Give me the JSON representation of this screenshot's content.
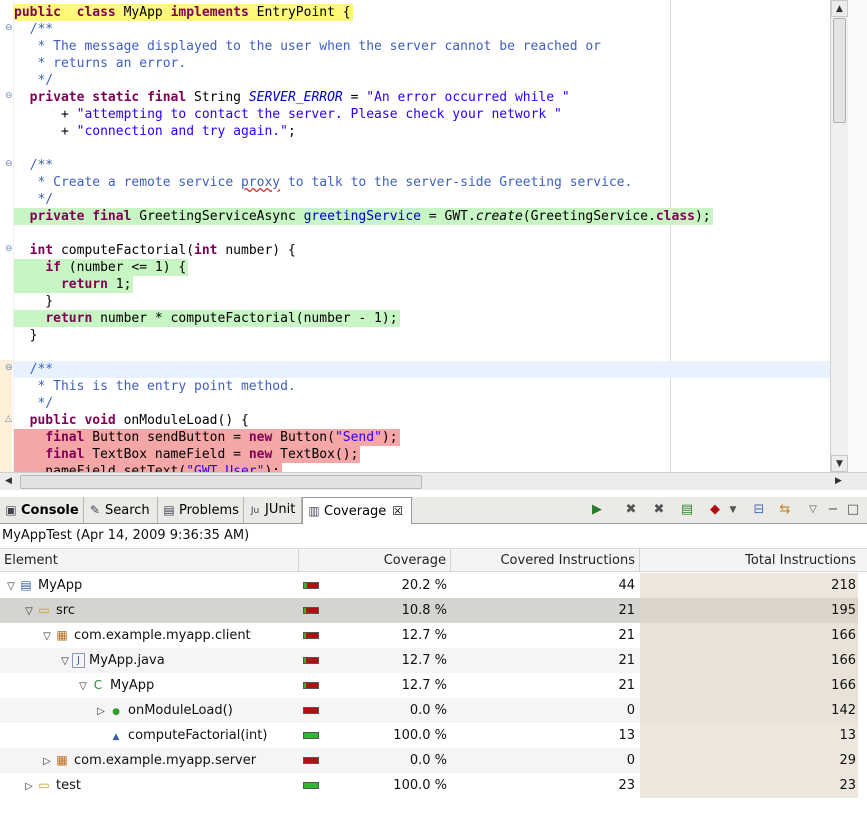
{
  "editor": {
    "lines": [
      {
        "hl": "y",
        "fold": "",
        "segs": [
          [
            "kw",
            "public"
          ],
          [
            "",
            "  "
          ],
          [
            "kw",
            "class"
          ],
          [
            "",
            " MyApp "
          ],
          [
            "kw",
            "implements"
          ],
          [
            "",
            " EntryPoint {"
          ]
        ]
      },
      {
        "hl": "",
        "fold": "⊖",
        "segs": [
          [
            "cm",
            "  /**"
          ]
        ]
      },
      {
        "hl": "",
        "fold": "",
        "segs": [
          [
            "cm",
            "   * The message displayed to the user when the server cannot be reached or"
          ]
        ]
      },
      {
        "hl": "",
        "fold": "",
        "segs": [
          [
            "cm",
            "   * returns an error."
          ]
        ]
      },
      {
        "hl": "",
        "fold": "",
        "segs": [
          [
            "cm",
            "   */"
          ]
        ]
      },
      {
        "hl": "",
        "fold": "⊖",
        "segs": [
          [
            "",
            "  "
          ],
          [
            "kw",
            "private"
          ],
          [
            "",
            " "
          ],
          [
            "kw",
            "static"
          ],
          [
            "",
            " "
          ],
          [
            "kw",
            "final"
          ],
          [
            "",
            " String "
          ],
          [
            "fi",
            "SERVER_ERROR"
          ],
          [
            "",
            " = "
          ],
          [
            "st",
            "\"An error occurred while \""
          ]
        ]
      },
      {
        "hl": "",
        "fold": "",
        "segs": [
          [
            "",
            "      + "
          ],
          [
            "st",
            "\"attempting to contact the server. Please check your network \""
          ]
        ]
      },
      {
        "hl": "",
        "fold": "",
        "segs": [
          [
            "",
            "      + "
          ],
          [
            "st",
            "\"connection and try again.\""
          ],
          [
            "",
            ";"
          ]
        ]
      },
      {
        "hl": "",
        "fold": "",
        "segs": [
          [
            "",
            ""
          ]
        ]
      },
      {
        "hl": "",
        "fold": "⊖",
        "segs": [
          [
            "cm",
            "  /**"
          ]
        ]
      },
      {
        "hl": "",
        "fold": "",
        "segs": [
          [
            "cm",
            "   * Create a remote service "
          ],
          [
            "cm ul",
            "proxy"
          ],
          [
            "cm",
            " to talk to the server-side Greeting service."
          ]
        ]
      },
      {
        "hl": "",
        "fold": "",
        "segs": [
          [
            "cm",
            "   */"
          ]
        ]
      },
      {
        "hl": "g",
        "fold": "",
        "segs": [
          [
            "",
            "  "
          ],
          [
            "kw",
            "private"
          ],
          [
            "",
            " "
          ],
          [
            "kw",
            "final"
          ],
          [
            "",
            " GreetingServiceAsync "
          ],
          [
            "fn",
            "greetingService"
          ],
          [
            "",
            " = GWT."
          ],
          [
            "it",
            "create"
          ],
          [
            "",
            "(GreetingService."
          ],
          [
            "kw",
            "class"
          ],
          [
            "",
            ");"
          ]
        ]
      },
      {
        "hl": "",
        "fold": "",
        "segs": [
          [
            "",
            ""
          ]
        ]
      },
      {
        "hl": "",
        "fold": "⊖",
        "segs": [
          [
            "",
            "  "
          ],
          [
            "kw",
            "int"
          ],
          [
            "",
            " computeFactorial("
          ],
          [
            "kw",
            "int"
          ],
          [
            "",
            " number) {"
          ]
        ]
      },
      {
        "hl": "g",
        "fold": "",
        "segs": [
          [
            "",
            "    "
          ],
          [
            "kw",
            "if"
          ],
          [
            "",
            " (number <= 1) {"
          ]
        ]
      },
      {
        "hl": "g",
        "fold": "",
        "segs": [
          [
            "",
            "      "
          ],
          [
            "kw",
            "return"
          ],
          [
            "",
            " 1;"
          ]
        ]
      },
      {
        "hl": "",
        "fold": "",
        "segs": [
          [
            "",
            "    }"
          ]
        ]
      },
      {
        "hl": "g",
        "fold": "",
        "segs": [
          [
            "",
            "    "
          ],
          [
            "kw",
            "return"
          ],
          [
            "",
            " number * computeFactorial(number - 1);"
          ]
        ]
      },
      {
        "hl": "",
        "fold": "",
        "segs": [
          [
            "",
            "  }"
          ]
        ]
      },
      {
        "hl": "",
        "fold": "",
        "segs": [
          [
            "",
            ""
          ]
        ]
      },
      {
        "hl": "b",
        "fold": "⊖",
        "segs": [
          [
            "cm",
            "  /**"
          ]
        ]
      },
      {
        "hl": "",
        "fold": "",
        "segs": [
          [
            "cm",
            "   * This is the entry point method."
          ]
        ]
      },
      {
        "hl": "",
        "fold": "",
        "segs": [
          [
            "cm",
            "   */"
          ]
        ]
      },
      {
        "hl": "",
        "fold": "△",
        "segs": [
          [
            "",
            "  "
          ],
          [
            "kw",
            "public"
          ],
          [
            "",
            " "
          ],
          [
            "kw",
            "void"
          ],
          [
            "",
            " onModuleLoad() {"
          ]
        ]
      },
      {
        "hl": "r",
        "fold": "",
        "segs": [
          [
            "",
            "    "
          ],
          [
            "kw",
            "final"
          ],
          [
            "",
            " Button sendButton = "
          ],
          [
            "kw",
            "new"
          ],
          [
            "",
            " Button("
          ],
          [
            "st",
            "\"Send\""
          ],
          [
            "",
            ");"
          ]
        ]
      },
      {
        "hl": "r",
        "fold": "",
        "segs": [
          [
            "",
            "    "
          ],
          [
            "kw",
            "final"
          ],
          [
            "",
            " TextBox nameField = "
          ],
          [
            "kw",
            "new"
          ],
          [
            "",
            " TextBox();"
          ]
        ]
      },
      {
        "hl": "r",
        "fold": "",
        "segs": [
          [
            "",
            "    nameField.setText("
          ],
          [
            "st",
            "\"GWT User\""
          ],
          [
            "",
            ");"
          ]
        ]
      }
    ]
  },
  "tabs": [
    {
      "label": "Console",
      "icon": "▣",
      "active": false,
      "bold": true
    },
    {
      "label": "Search",
      "icon": "✎",
      "active": false
    },
    {
      "label": "Problems",
      "icon": "▤",
      "active": false
    },
    {
      "label": "JUnit",
      "icon": "Ju",
      "active": false
    },
    {
      "label": "Coverage",
      "icon": "▥",
      "active": true
    }
  ],
  "coverage": {
    "session": "MyAppTest (Apr 14, 2009 9:36:35 AM)",
    "columns": [
      "Element",
      "Coverage",
      "Covered Instructions",
      "Total Instructions"
    ],
    "rows": [
      {
        "indent": 0,
        "tri": "▽",
        "icon": "project",
        "name": "MyApp",
        "pct": "20.2 %",
        "cov": "44",
        "total": "218",
        "ratio": 0.202,
        "bg": "",
        "shade": "s3"
      },
      {
        "indent": 1,
        "tri": "▽",
        "icon": "folder",
        "name": "src",
        "pct": "10.8 %",
        "cov": "21",
        "total": "195",
        "ratio": 0.108,
        "bg": "sel",
        "shade": "s2"
      },
      {
        "indent": 2,
        "tri": "▽",
        "icon": "package",
        "name": "com.example.myapp.client",
        "pct": "12.7 %",
        "cov": "21",
        "total": "166",
        "ratio": 0.127,
        "bg": "",
        "shade": "s1"
      },
      {
        "indent": 3,
        "tri": "▽",
        "icon": "file",
        "name": "MyApp.java",
        "pct": "12.7 %",
        "cov": "21",
        "total": "166",
        "ratio": 0.127,
        "bg": "alt",
        "shade": "s1"
      },
      {
        "indent": 4,
        "tri": "▽",
        "icon": "class",
        "name": "MyApp",
        "pct": "12.7 %",
        "cov": "21",
        "total": "166",
        "ratio": 0.127,
        "bg": "",
        "shade": "s1"
      },
      {
        "indent": 5,
        "tri": "▷",
        "icon": "method-public",
        "name": "onModuleLoad()",
        "pct": "0.0 %",
        "cov": "0",
        "total": "142",
        "ratio": 0.0,
        "bg": "alt",
        "shade": "s1"
      },
      {
        "indent": 5,
        "tri": "",
        "icon": "method-default",
        "name": "computeFactorial(int)",
        "pct": "100.0 %",
        "cov": "13",
        "total": "13",
        "ratio": 1.0,
        "bg": "",
        "shade": "s3"
      },
      {
        "indent": 2,
        "tri": "▷",
        "icon": "package",
        "name": "com.example.myapp.server",
        "pct": "0.0 %",
        "cov": "0",
        "total": "29",
        "ratio": 0.0,
        "bg": "alt",
        "shade": "s3"
      },
      {
        "indent": 1,
        "tri": "▷",
        "icon": "folder",
        "name": "test",
        "pct": "100.0 %",
        "cov": "23",
        "total": "23",
        "ratio": 1.0,
        "bg": "",
        "shade": "s3"
      }
    ]
  },
  "icons": {
    "project": "▤",
    "folder": "▭",
    "package": "▦",
    "file": "J",
    "class": "C",
    "method-public": "●",
    "method-default": "▲"
  },
  "colors": {
    "covered": "#2fb82f",
    "missed": "#b11010",
    "highlight_full": "#c7f5c4",
    "highlight_none": "#f5a6a6",
    "highlight_current": "#fbf87a"
  }
}
